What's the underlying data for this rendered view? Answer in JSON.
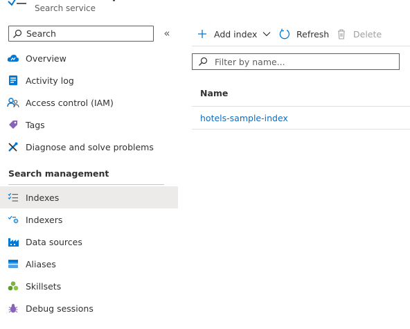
{
  "header": {
    "title": "srch-ai-sample",
    "subtitle": "Search service"
  },
  "sidebar": {
    "search_placeholder": "Search",
    "collapse_glyph": "«",
    "items": [
      {
        "label": "Overview",
        "icon": "cloud-icon"
      },
      {
        "label": "Activity log",
        "icon": "activity-log-icon"
      },
      {
        "label": "Access control (IAM)",
        "icon": "people-icon"
      },
      {
        "label": "Tags",
        "icon": "tag-icon"
      },
      {
        "label": "Diagnose and solve problems",
        "icon": "wrench-icon"
      }
    ],
    "section_title": "Search management",
    "section_items": [
      {
        "label": "Indexes",
        "icon": "checklist-icon",
        "selected": true
      },
      {
        "label": "Indexers",
        "icon": "indexer-icon"
      },
      {
        "label": "Data sources",
        "icon": "factory-icon"
      },
      {
        "label": "Aliases",
        "icon": "alias-icon"
      },
      {
        "label": "Skillsets",
        "icon": "skillset-icon"
      },
      {
        "label": "Debug sessions",
        "icon": "bug-icon"
      }
    ]
  },
  "toolbar": {
    "add_index": "Add index",
    "refresh": "Refresh",
    "delete": "Delete"
  },
  "filter": {
    "placeholder": "Filter by name..."
  },
  "table": {
    "columns": [
      "Name"
    ],
    "rows": [
      {
        "name": "hotels-sample-index"
      }
    ]
  },
  "colors": {
    "accent": "#0f6cbd",
    "selected_bg": "#edebe9",
    "text": "#323130",
    "disabled": "#a19f9d"
  }
}
